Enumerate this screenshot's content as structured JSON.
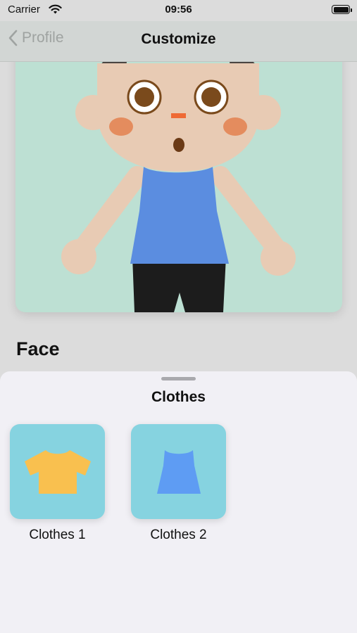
{
  "status_bar": {
    "carrier": "Carrier",
    "time": "09:56"
  },
  "nav": {
    "back_label": "Profile",
    "title": "Customize"
  },
  "main": {
    "section_title": "Face"
  },
  "sheet": {
    "title": "Clothes",
    "items": [
      {
        "label": "Clothes 1",
        "icon": "tshirt-icon",
        "color": "#f9c04f"
      },
      {
        "label": "Clothes 2",
        "icon": "tanktop-icon",
        "color": "#5e9cf3"
      }
    ]
  },
  "colors": {
    "avatar_background": "#bde0d3",
    "skin": "#e8cbb4",
    "hair": "#4a4541",
    "top": "#5b8de0",
    "shorts": "#1c1c1c",
    "tile_background": "#86d3e0",
    "sheet_background": "#f1f0f5"
  }
}
